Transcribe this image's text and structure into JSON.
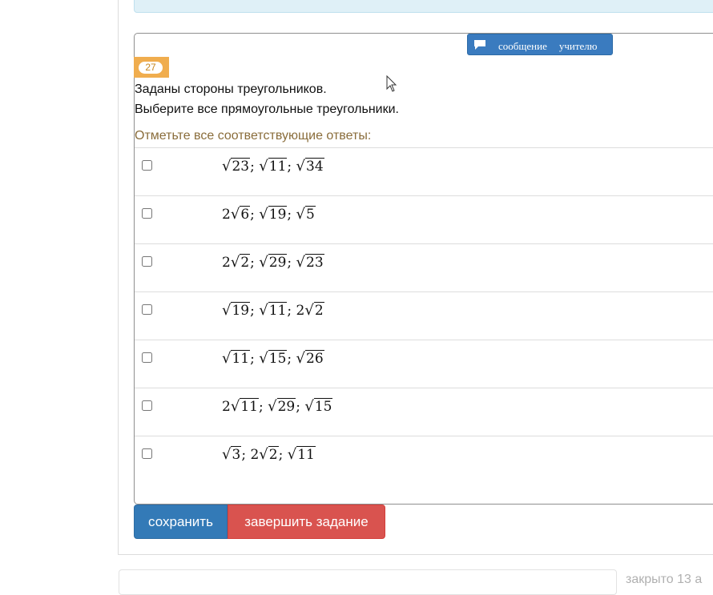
{
  "message_button": {
    "icon": "chat-bubble-icon",
    "word1": "сообщение",
    "word2": "учителю"
  },
  "task": {
    "number": "27",
    "question_line1": "Заданы стороны треугольников.",
    "question_line2": "Выберите все прямоугольные треугольники.",
    "instruction": "Отметьте все соответствующие ответы:",
    "answers": [
      [
        {
          "r": "23"
        },
        {
          "r": "11"
        },
        {
          "r": "34"
        }
      ],
      [
        {
          "c": "2",
          "r": "6"
        },
        {
          "r": "19"
        },
        {
          "r": "5"
        }
      ],
      [
        {
          "c": "2",
          "r": "2"
        },
        {
          "r": "29"
        },
        {
          "r": "23"
        }
      ],
      [
        {
          "r": "19"
        },
        {
          "r": "11"
        },
        {
          "c": "2",
          "r": "2"
        }
      ],
      [
        {
          "r": "11"
        },
        {
          "r": "15"
        },
        {
          "r": "26"
        }
      ],
      [
        {
          "c": "2",
          "r": "11"
        },
        {
          "r": "29"
        },
        {
          "r": "15"
        }
      ],
      [
        {
          "r": "3"
        },
        {
          "c": "2",
          "r": "2"
        },
        {
          "r": "11"
        }
      ]
    ]
  },
  "buttons": {
    "save": "сохранить",
    "finish": "завершить задание"
  },
  "footer": {
    "closed_text": "закрыто 13 а"
  },
  "colors": {
    "primary": "#337ab7",
    "danger": "#d9534f",
    "badge": "#f0ad4e",
    "instruction": "#8a6d3b"
  }
}
